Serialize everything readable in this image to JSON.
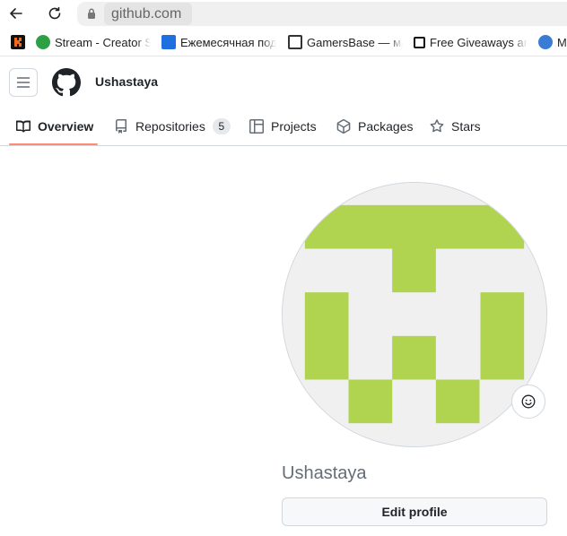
{
  "browser": {
    "url": "github.com",
    "bookmarks": [
      {
        "label": "Stream - Creator S",
        "icon": "stream-favicon",
        "color": "#2ea043"
      },
      {
        "label": "Ежемесячная под",
        "icon": "vk-favicon",
        "color": "#1e6fe0"
      },
      {
        "label": "GamersBase — ма",
        "icon": "gamersbase-favicon",
        "color": "#333333"
      },
      {
        "label": "Free Giveaways ar",
        "icon": "giveaways-favicon",
        "color": "#111111"
      },
      {
        "label": "M",
        "icon": "m-favicon",
        "color": "#3a7bd5"
      }
    ]
  },
  "header": {
    "username": "Ushastaya"
  },
  "tabs": [
    {
      "label": "Overview",
      "icon": "book-icon",
      "active": true
    },
    {
      "label": "Repositories",
      "icon": "repo-icon",
      "count": "5"
    },
    {
      "label": "Projects",
      "icon": "table-icon"
    },
    {
      "label": "Packages",
      "icon": "package-icon"
    },
    {
      "label": "Stars",
      "icon": "star-icon"
    }
  ],
  "profile": {
    "display_name": "Ushastaya",
    "edit_button": "Edit profile",
    "avatar_color": "#b0d450"
  },
  "colors": {
    "accent_underline": "#fd8c73",
    "muted_text": "#656d76"
  }
}
